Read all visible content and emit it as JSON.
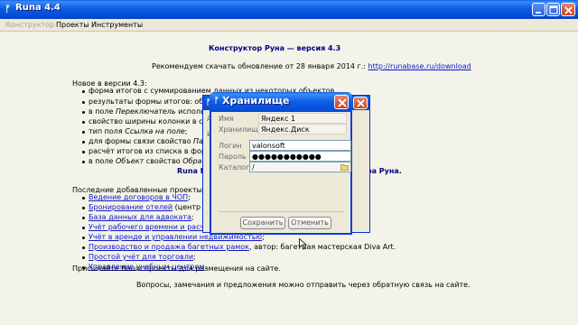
{
  "window": {
    "title": "Runa 4.4",
    "app_icon": "rune-icon"
  },
  "menu": [
    {
      "label": "Конструктор",
      "disabled": true
    },
    {
      "label": "Проекты",
      "disabled": false
    },
    {
      "label": "Инструменты",
      "disabled": false
    }
  ],
  "page": {
    "heading": "Конструктор Руна — версия 4.3",
    "update_prefix": "Рекомендуем скачать обновление от 28 января 2014 г.: ",
    "update_link": "http://runabase.ru/download",
    "new_in_title": "Новое в версии 4.3:",
    "new_items": [
      "форма итогов с суммированием данных из некоторых объектов",
      "результаты формы итогов: общие",
      "в поле Переключатель использова",
      "свойство ширины колонки в списке",
      "тип поля Ссылка на поле;",
      "для формы связи свойство Папка",
      "расчёт итогов из списка в форме",
      "в поле Объект свойство Обратная"
    ],
    "runa_line_left": "Runa M",
    "runa_line_right": "стора Руна.",
    "recent_title": "Последние добавленные проекты:",
    "projects": [
      {
        "link": "Ведение договоров в ЧОП",
        "tail": ";"
      },
      {
        "link": "Бронирование отелей",
        "tail": " (центр InnE"
      },
      {
        "link": "База данных для адвоката",
        "tail": ";"
      },
      {
        "link": "Учёт рабочего времени и расчёт з",
        "tail": ""
      },
      {
        "link": "Учёт в аренде и управлении недвижимостью",
        "tail": ";"
      },
      {
        "link": "Производство и продажа багетных рамок",
        "tail": ", автор: багетная мастерская Diva Art."
      },
      {
        "link": "Простой учёт для торговли",
        "tail": ";"
      },
      {
        "link": "Управление учебным центром",
        "tail": "."
      }
    ],
    "send_projects": "Присылайте Ваши проекты для размещения на сайте.",
    "feedback": "Вопросы, замечания и предложения можно отправить через обратную связь на сайте."
  },
  "bg_dialog": {
    "partial_label_1": "А",
    "partial_label_2": "Ис"
  },
  "storage_dialog": {
    "title": "Хранилище",
    "name_label": "Имя",
    "name_value": "Яндекс 1",
    "storage_label": "Хранилище",
    "storage_value": "Яндекс.Диск",
    "login_label": "Логин",
    "login_value": "valonsoft",
    "password_label": "Пароль",
    "password_value": "●●●●●●●●●●●",
    "catalog_label": "Каталог",
    "catalog_value": "/",
    "save_label": "Сохранить",
    "cancel_label": "Отменить"
  },
  "colors": {
    "title_blue": "#0b5ee5",
    "heading_navy": "#000080",
    "link_blue": "#1018c8",
    "close_red": "#c8431d",
    "window_bg": "#ece9d8"
  }
}
